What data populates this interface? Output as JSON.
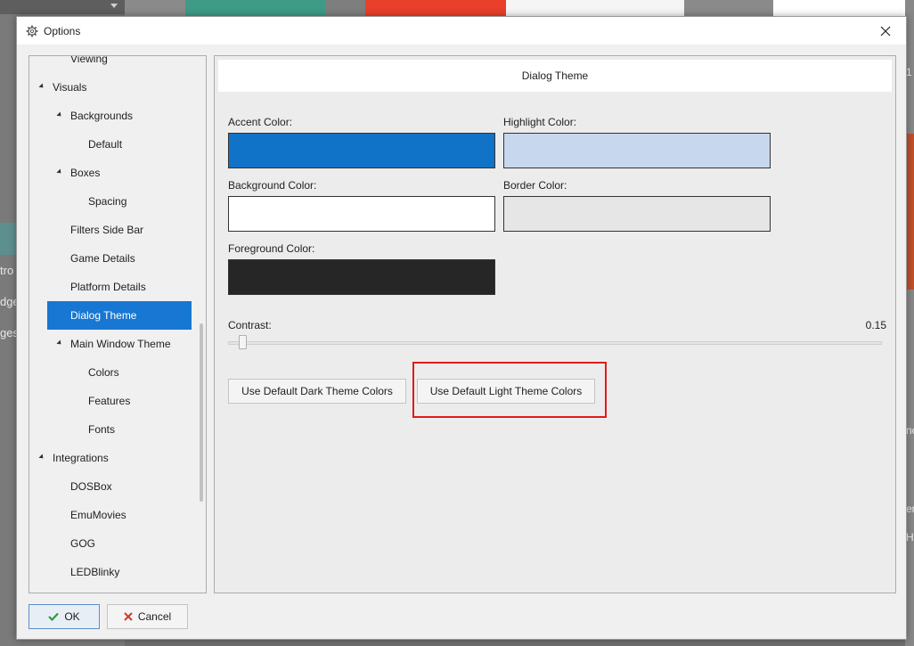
{
  "window": {
    "title": "Options"
  },
  "tree": {
    "items": [
      {
        "label": "Viewing",
        "level": 1,
        "expander": false
      },
      {
        "label": "Visuals",
        "level": 0,
        "expander": true
      },
      {
        "label": "Backgrounds",
        "level": 1,
        "expander": true
      },
      {
        "label": "Default",
        "level": 2,
        "expander": false
      },
      {
        "label": "Boxes",
        "level": 1,
        "expander": true
      },
      {
        "label": "Spacing",
        "level": 2,
        "expander": false
      },
      {
        "label": "Filters Side Bar",
        "level": 1,
        "expander": false
      },
      {
        "label": "Game Details",
        "level": 1,
        "expander": false
      },
      {
        "label": "Platform Details",
        "level": 1,
        "expander": false
      },
      {
        "label": "Dialog Theme",
        "level": 1,
        "expander": false,
        "selected": true
      },
      {
        "label": "Main Window Theme",
        "level": 1,
        "expander": true
      },
      {
        "label": "Colors",
        "level": 2,
        "expander": false
      },
      {
        "label": "Features",
        "level": 2,
        "expander": false
      },
      {
        "label": "Fonts",
        "level": 2,
        "expander": false
      },
      {
        "label": "Integrations",
        "level": 0,
        "expander": true
      },
      {
        "label": "DOSBox",
        "level": 1,
        "expander": false
      },
      {
        "label": "EmuMovies",
        "level": 1,
        "expander": false
      },
      {
        "label": "GOG",
        "level": 1,
        "expander": false
      },
      {
        "label": "LEDBlinky",
        "level": 1,
        "expander": false
      }
    ]
  },
  "content": {
    "header": "Dialog Theme",
    "accent_label": "Accent Color:",
    "highlight_label": "Highlight Color:",
    "background_label": "Background Color:",
    "border_label": "Border Color:",
    "foreground_label": "Foreground Color:",
    "contrast_label": "Contrast:",
    "contrast_value": "0.15",
    "dark_button": "Use Default Dark Theme Colors",
    "light_button": "Use Default Light Theme Colors"
  },
  "colors": {
    "accent": "#1173c8",
    "highlight": "#c7d8ee",
    "background": "#ffffff",
    "border": "#e6e6e6",
    "foreground": "#262626",
    "selection": "#1777d2",
    "callout": "#e01b1b"
  },
  "footer": {
    "ok_label": "OK",
    "cancel_label": "Cancel"
  },
  "background_app": {
    "left_texts": [
      "tro",
      "dge",
      "ges"
    ],
    "right_texts": [
      "1",
      "nc",
      "er",
      "H"
    ]
  }
}
